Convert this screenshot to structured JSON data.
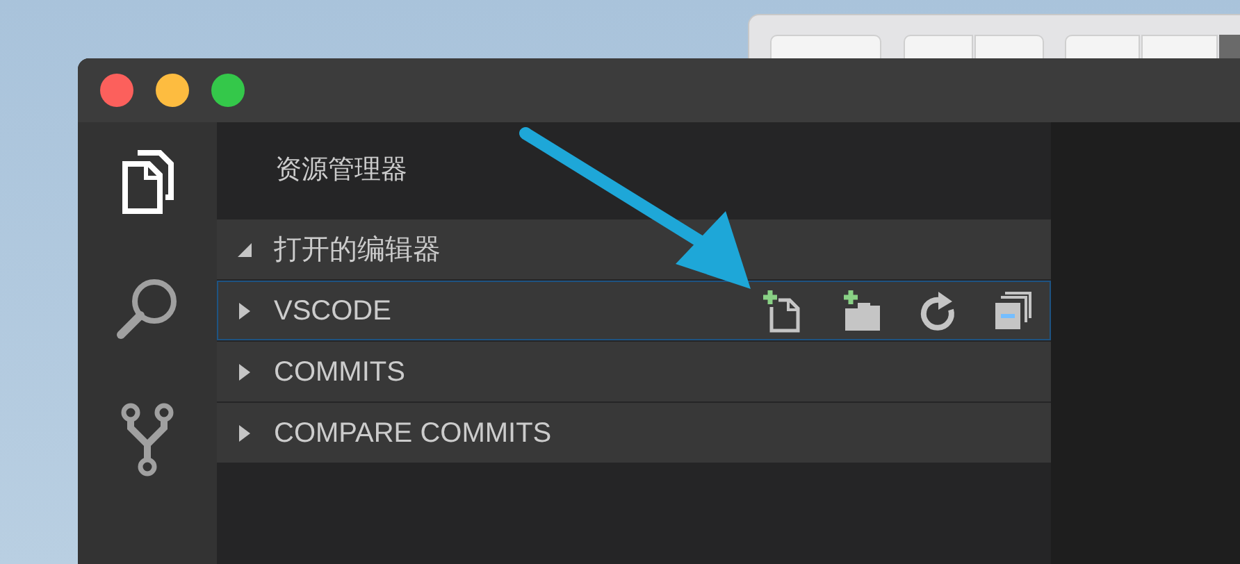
{
  "activity_bar": [
    {
      "kind": "explorer",
      "selected": true
    },
    {
      "kind": "search",
      "selected": false
    },
    {
      "kind": "source-control",
      "selected": false
    }
  ],
  "sidebar": {
    "title": "资源管理器",
    "sections": [
      {
        "label": "打开的编辑器",
        "expanded": true,
        "focused": false,
        "actions": false
      },
      {
        "label": "VSCODE",
        "expanded": false,
        "focused": true,
        "actions": true
      },
      {
        "label": "COMMITS",
        "expanded": false,
        "focused": false,
        "actions": false
      },
      {
        "label": "COMPARE COMMITS",
        "expanded": false,
        "focused": false,
        "actions": false
      }
    ]
  }
}
